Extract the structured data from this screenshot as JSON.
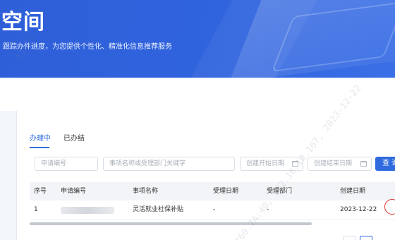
{
  "banner": {
    "title": "空间",
    "subtitle": "跟踪办件进度，为您提供个性化、精准化信息推荐服务"
  },
  "tabs": [
    {
      "label": "办理中",
      "active": true
    },
    {
      "label": "已办结",
      "active": false
    }
  ],
  "filters": {
    "apply_no_placeholder": "申请编号",
    "keyword_placeholder": "事项名称或受理部门关键字",
    "start_date_placeholder": "创建开始日期",
    "end_date_placeholder": "创建结束日期",
    "search_label": "查 询"
  },
  "table": {
    "columns": [
      "序号",
      "申请编号",
      "事项名称",
      "受理日期",
      "受理部门",
      "创建日期"
    ],
    "rows": [
      {
        "index": "1",
        "apply_no": "",
        "item_name": "灵活就业社保补贴",
        "accept_date": "-",
        "accept_dept": "-",
        "create_date": "2023-12-22"
      }
    ]
  },
  "watermark": {
    "text": "*60.7A:40, 172.16.10.167, 2023-12-22",
    "fragment": "11:21"
  },
  "colors": {
    "primary": "#2f6bdf",
    "banner": "#2f5fd8",
    "highlight_circle": "#e0342c"
  }
}
